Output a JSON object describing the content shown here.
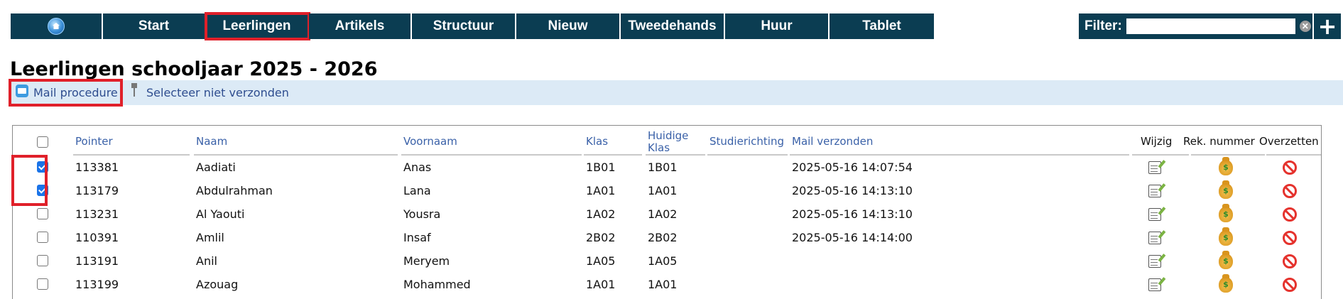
{
  "nav": {
    "home_icon": "home-globe-icon",
    "items": [
      {
        "label": "Start"
      },
      {
        "label": "Leerlingen"
      },
      {
        "label": "Artikels"
      },
      {
        "label": "Structuur"
      },
      {
        "label": "Nieuw"
      },
      {
        "label": "Tweedehands"
      },
      {
        "label": "Huur"
      },
      {
        "label": "Tablet"
      }
    ],
    "active": "Leerlingen"
  },
  "filter": {
    "label": "Filter:",
    "value": "",
    "clear_symbol": "✕",
    "add_symbol": "+"
  },
  "page": {
    "title": "Leerlingen schooljaar 2025 - 2026"
  },
  "toolbar": {
    "mail_label": "Mail procedure",
    "select_label": "Selecteer niet verzonden"
  },
  "table": {
    "headers": {
      "pointer": "Pointer",
      "naam": "Naam",
      "voornaam": "Voornaam",
      "klas": "Klas",
      "huidige_klas_1": "Huidige",
      "huidige_klas_2": "Klas",
      "studierichting": "Studierichting",
      "mail_verzonden": "Mail verzonden",
      "wijzig": "Wijzig",
      "rek_nummer": "Rek. nummer",
      "overzetten": "Overzetten"
    },
    "rows": [
      {
        "checked": true,
        "pointer": "113381",
        "naam": "Aadiati",
        "voornaam": "Anas",
        "klas": "1B01",
        "huidige_klas": "1B01",
        "studierichting": "",
        "mail_verzonden": "2025-05-16 14:07:54"
      },
      {
        "checked": true,
        "pointer": "113179",
        "naam": "Abdulrahman",
        "voornaam": "Lana",
        "klas": "1A01",
        "huidige_klas": "1A01",
        "studierichting": "",
        "mail_verzonden": "2025-05-16 14:13:10"
      },
      {
        "checked": false,
        "pointer": "113231",
        "naam": "Al Yaouti",
        "voornaam": "Yousra",
        "klas": "1A02",
        "huidige_klas": "1A02",
        "studierichting": "",
        "mail_verzonden": "2025-05-16 14:13:10"
      },
      {
        "checked": false,
        "pointer": "110391",
        "naam": "Amlil",
        "voornaam": "Insaf",
        "klas": "2B02",
        "huidige_klas": "2B02",
        "studierichting": "",
        "mail_verzonden": "2025-05-16 14:14:00"
      },
      {
        "checked": false,
        "pointer": "113191",
        "naam": "Anil",
        "voornaam": "Meryem",
        "klas": "1A05",
        "huidige_klas": "1A05",
        "studierichting": "",
        "mail_verzonden": ""
      },
      {
        "checked": false,
        "pointer": "113199",
        "naam": "Azouag",
        "voornaam": "Mohammed",
        "klas": "1A01",
        "huidige_klas": "1A01",
        "studierichting": "",
        "mail_verzonden": ""
      }
    ]
  },
  "icons": {
    "wijzig": "edit-notepad-icon",
    "rek_nummer": "money-bag-icon",
    "overzetten": "no-entry-icon"
  }
}
